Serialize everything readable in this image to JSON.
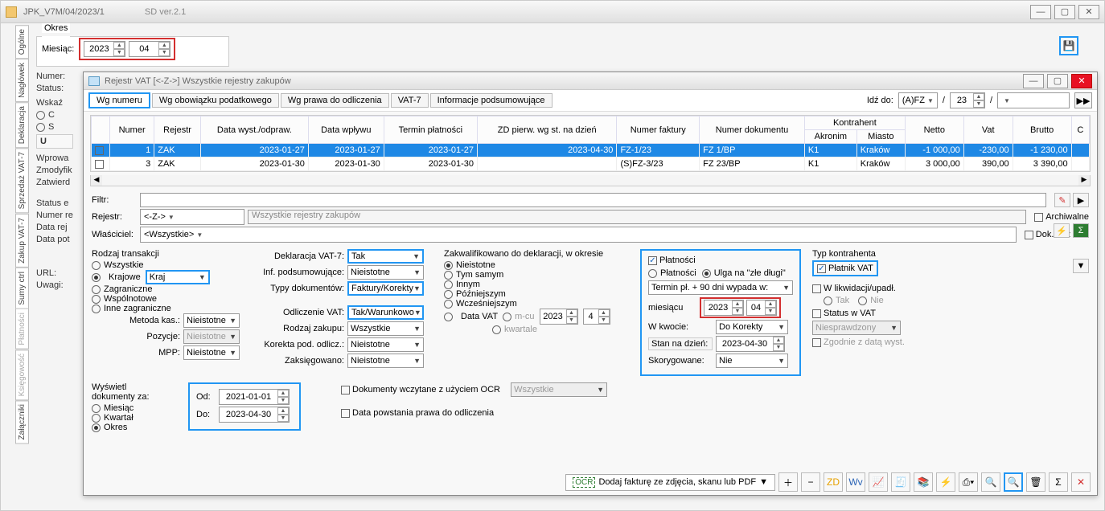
{
  "outer": {
    "title": "JPK_V7M/04/2023/1",
    "version": "SD ver.2.1"
  },
  "side_tabs": [
    "Ogólne",
    "Nagłówek",
    "Deklaracja",
    "Sprzedaż VAT-7",
    "Zakup VAT-7",
    "Sumy ctrl",
    "Płatności",
    "Księgowość",
    "Załączniki"
  ],
  "okres": {
    "group": "Okres",
    "label": "Miesiąc:",
    "year": "2023",
    "month": "04"
  },
  "left": {
    "numer": "Numer:",
    "status": "Status:",
    "wska": "Wskaź",
    "c": "C",
    "s": "S",
    "u": "U",
    "wprowadzil": "Wprowa",
    "zmodyfikowal": "Zmodyfik",
    "zatwierdzil": "Zatwierd",
    "status_e": "Status e",
    "numer_re": "Numer re",
    "data_rej": "Data rej",
    "data_pot": "Data pot",
    "url": "URL:",
    "uwagi": "Uwagi:"
  },
  "inner": {
    "title_app": "Rejestr VAT  [<-Z->]   Wszystkie rejestry zakupów",
    "tabs": [
      "Wg numeru",
      "Wg obowiązku podatkowego",
      "Wg prawa do odliczenia",
      "VAT-7",
      "Informacje podsumowujące"
    ],
    "goto_label": "Idź do:",
    "goto_reg": "(A)FZ",
    "goto_num": "23",
    "cols": {
      "numer": "Numer",
      "rejestr": "Rejestr",
      "data_wyst": "Data wyst./odpraw.",
      "data_wplywu": "Data wpływu",
      "termin": "Termin płatności",
      "zd": "ZD pierw. wg st. na dzień",
      "nr_fakt": "Numer faktury",
      "nr_dok": "Numer dokumentu",
      "kontrahent": "Kontrahent",
      "akronim": "Akronim",
      "miasto": "Miasto",
      "netto": "Netto",
      "vat": "Vat",
      "brutto": "Brutto",
      "c": "C"
    },
    "rows": [
      {
        "sel": true,
        "numer": "1",
        "rejestr": "ZAK",
        "data_wyst": "2023-01-27",
        "data_wplywu": "2023-01-27",
        "termin": "2023-01-27",
        "zd": "2023-04-30",
        "nr_fakt": "FZ-1/23",
        "nr_dok": "FZ 1/BP",
        "akronim": "K1",
        "miasto": "Kraków",
        "netto": "-1 000,00",
        "vat": "-230,00",
        "brutto": "-1 230,00"
      },
      {
        "sel": false,
        "numer": "3",
        "rejestr": "ZAK",
        "data_wyst": "2023-01-30",
        "data_wplywu": "2023-01-30",
        "termin": "2023-01-30",
        "zd": "",
        "nr_fakt": "(S)FZ-3/23",
        "nr_dok": "FZ 23/BP",
        "akronim": "K1",
        "miasto": "Kraków",
        "netto": "3 000,00",
        "vat": "390,00",
        "brutto": "3 390,00"
      }
    ],
    "filtr": "Filtr:",
    "rejestr_lbl": "Rejestr:",
    "rejestr_val": "<-Z->",
    "rejestr_desc": "Wszystkie rejestry zakupów",
    "wlasciciel_lbl": "Właściciel:",
    "wlasciciel_val": "<Wszystkie>",
    "archiwalne": "Archiwalne",
    "dok_bez_vat": "Dok. bez VAT"
  },
  "rodzaj": {
    "label": "Rodzaj transakcji",
    "wszystkie": "Wszystkie",
    "krajowe": "Krajowe",
    "kraj": "Kraj",
    "zagraniczne": "Zagraniczne",
    "wspolnotowe": "Wspólnotowe",
    "inne": "Inne zagraniczne",
    "metoda": "Metoda kas.:",
    "metoda_v": "Nieistotne",
    "pozycje": "Pozycje:",
    "pozycje_v": "Nieistotne",
    "mpp": "MPP:",
    "mpp_v": "Nieistotne"
  },
  "dekl": {
    "vat7": "Deklaracja VAT-7:",
    "vat7_v": "Tak",
    "inf": "Inf. podsumowujące:",
    "inf_v": "Nieistotne",
    "typy": "Typy dokumentów:",
    "typy_v": "Faktury/Korekty",
    "odl": "Odliczenie VAT:",
    "odl_v": "Tak/Warunkowo",
    "rodzaj": "Rodzaj zakupu:",
    "rodzaj_v": "Wszystkie",
    "kor": "Korekta pod. odlicz.:",
    "kor_v": "Nieistotne",
    "zak": "Zaksięgowano:",
    "zak_v": "Nieistotne"
  },
  "zakw": {
    "label": "Zakwalifikowano do deklaracji, w okresie",
    "nieistotne": "Nieistotne",
    "tym": "Tym samym",
    "innym": "Innym",
    "poz": "Późniejszym",
    "wcz": "Wcześniejszym",
    "data_vat": "Data VAT",
    "mcu": "m-cu",
    "kwartale": "kwartale",
    "rok": "2023",
    "mies": "4"
  },
  "plat": {
    "chk": "Płatności",
    "opt_plat": "Płatności",
    "opt_ulga": "Ulga na \"złe długi\"",
    "termin": "Termin pł. + 90 dni wypada w:",
    "mies_lbl": "miesiącu",
    "rok": "2023",
    "mies": "04",
    "wkw": "W kwocie:",
    "wkw_v": "Do Korekty",
    "stan": "Stan na dzień:",
    "stan_v": "2023-04-30",
    "skor": "Skorygowane:",
    "skor_v": "Nie"
  },
  "typk": {
    "label": "Typ kontrahenta",
    "platnik": "Płatnik VAT",
    "likw": "W likwidacji/upadł.",
    "tak": "Tak",
    "nie": "Nie",
    "status": "Status w VAT",
    "niespr": "Niesprawdzony",
    "zgod": "Zgodnie z datą wyst."
  },
  "wysw": {
    "label": "Wyświetl dokumenty za:",
    "miesiac": "Miesiąc",
    "kwartal": "Kwartał",
    "okres": "Okres",
    "od": "Od:",
    "od_v": "2021-01-01",
    "do": "Do:",
    "do_v": "2023-04-30"
  },
  "extra": {
    "ocr_chk": "Dokumenty wczytane z użyciem OCR",
    "ocr_v": "Wszystkie",
    "data_praw": "Data powstania prawa do odliczenia",
    "ocr_btn": "Dodaj fakturę ze zdjęcia, skanu lub PDF",
    "ocr_tag": "OCR"
  }
}
